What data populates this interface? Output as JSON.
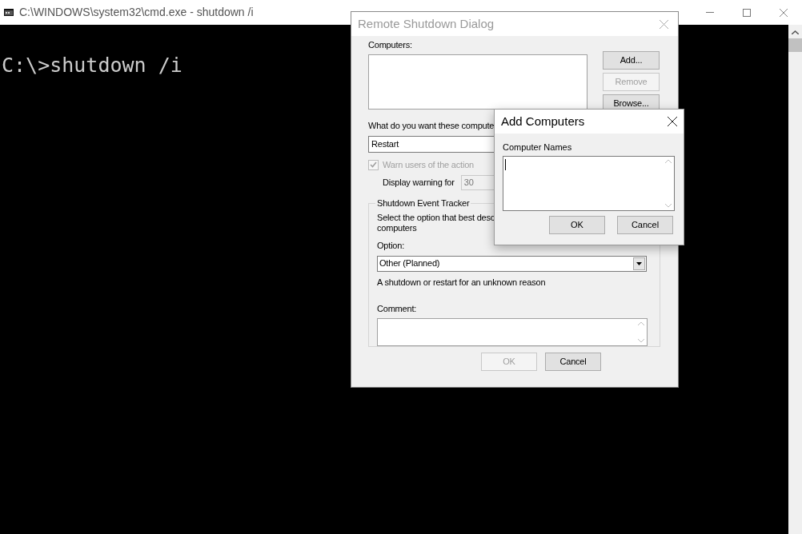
{
  "console": {
    "title": "C:\\WINDOWS\\system32\\cmd.exe - shutdown  /i",
    "lines": [
      "C:\\>shutdown /i"
    ]
  },
  "remote_dialog": {
    "title": "Remote Shutdown Dialog",
    "computers_label": "Computers:",
    "side_buttons": [
      {
        "label": "Add...",
        "disabled": false
      },
      {
        "label": "Remove",
        "disabled": true
      },
      {
        "label": "Browse...",
        "disabled": false
      }
    ],
    "action_label": "What do you want these compute",
    "action_value": "Restart",
    "warn": {
      "label": "Warn users of the action",
      "checked": true,
      "disabled": true
    },
    "warning_label": "Display warning for",
    "warning_value": "30",
    "tracker": {
      "title": "Shutdown Event Tracker",
      "description": [
        "Select the option that best desc",
        "computers"
      ],
      "option_label": "Option:",
      "option_value": "Other (Planned)",
      "reason": "A shutdown or restart for an unknown reason",
      "comment_label": "Comment:"
    },
    "buttons": [
      {
        "label": "OK",
        "disabled": true
      },
      {
        "label": "Cancel",
        "disabled": false
      }
    ]
  },
  "add_dialog": {
    "title": "Add Computers",
    "names_label": "Computer Names",
    "buttons": [
      {
        "label": "OK",
        "disabled": false
      },
      {
        "label": "Cancel",
        "disabled": false
      }
    ]
  }
}
